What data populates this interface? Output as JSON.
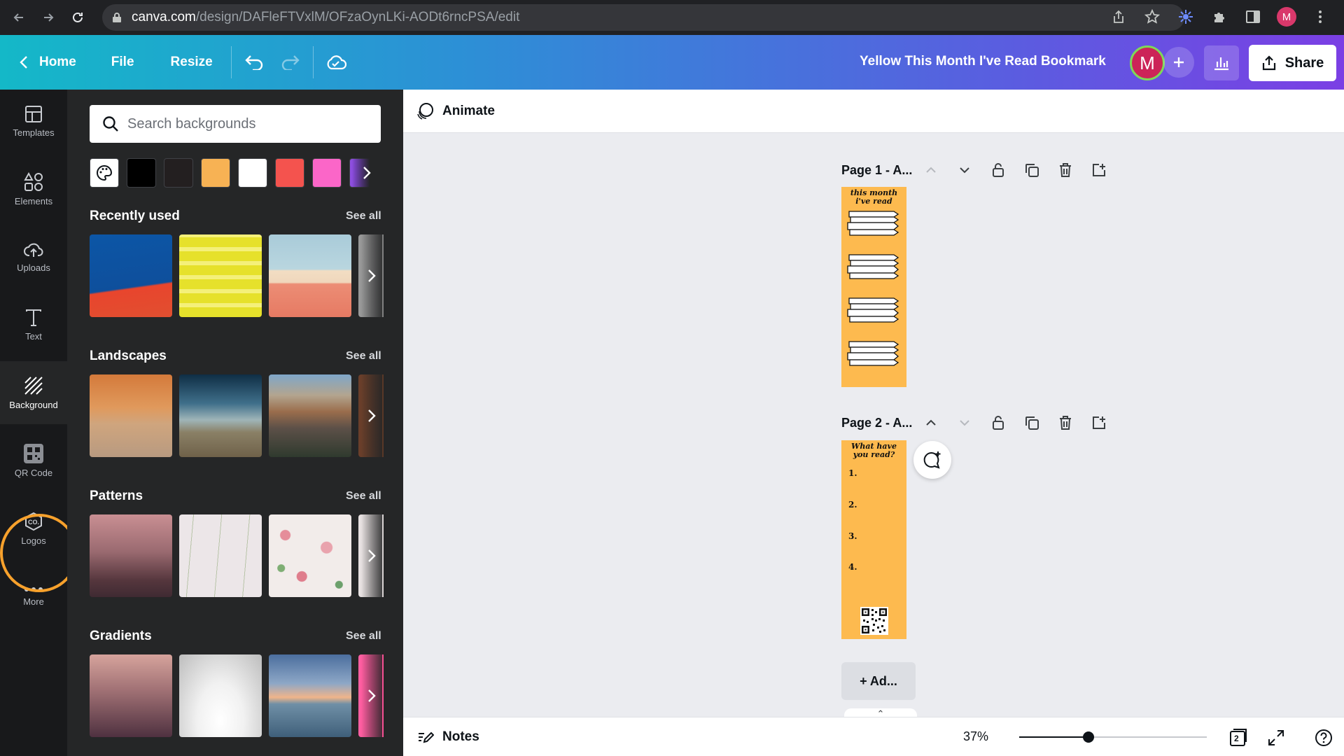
{
  "browser": {
    "url_domain": "canva.com",
    "url_path": "/design/DAFleFTVxlM/OFzaOynLKi-AODt6rncPSA/edit",
    "profile_initial": "M"
  },
  "toolbar": {
    "home_label": "Home",
    "file_label": "File",
    "resize_label": "Resize",
    "design_title": "Yellow This Month I've Read Bookmark",
    "avatar_initial": "M",
    "share_label": "Share"
  },
  "rail": {
    "items": [
      {
        "label": "Templates",
        "icon": "templates-icon"
      },
      {
        "label": "Elements",
        "icon": "elements-icon"
      },
      {
        "label": "Uploads",
        "icon": "uploads-icon"
      },
      {
        "label": "Text",
        "icon": "text-icon"
      },
      {
        "label": "Background",
        "icon": "background-icon"
      },
      {
        "label": "QR Code",
        "icon": "qr-code-icon"
      },
      {
        "label": "Logos",
        "icon": "logos-icon"
      },
      {
        "label": "More",
        "icon": "more-icon"
      }
    ],
    "active": "Background"
  },
  "panel": {
    "search_placeholder": "Search backgrounds",
    "swatches": [
      "#000000",
      "#231f20",
      "#f7b254",
      "#ffffff",
      "#f4534e",
      "#fb66c8",
      "#8e4fe0"
    ],
    "sections": [
      {
        "title": "Recently used",
        "see_all": "See all"
      },
      {
        "title": "Landscapes",
        "see_all": "See all"
      },
      {
        "title": "Patterns",
        "see_all": "See all"
      },
      {
        "title": "Gradients",
        "see_all": "See all"
      }
    ]
  },
  "editor": {
    "animate_label": "Animate",
    "pages": [
      {
        "label": "Page 1 - A...",
        "heading": "this month i've read"
      },
      {
        "label": "Page 2 - A...",
        "heading": "What have you read?",
        "list": [
          "1.",
          "2.",
          "3.",
          "4."
        ]
      }
    ],
    "add_page_label": "+ Ad..."
  },
  "footer": {
    "notes_label": "Notes",
    "zoom_text": "37%",
    "zoom_level": 0.37,
    "page_count": "2"
  },
  "colors": {
    "accent_ring": "#f7a12c",
    "bookmark_yellow": "#fdba4f",
    "rail_bg": "#18191b",
    "panel_bg": "#252627"
  }
}
